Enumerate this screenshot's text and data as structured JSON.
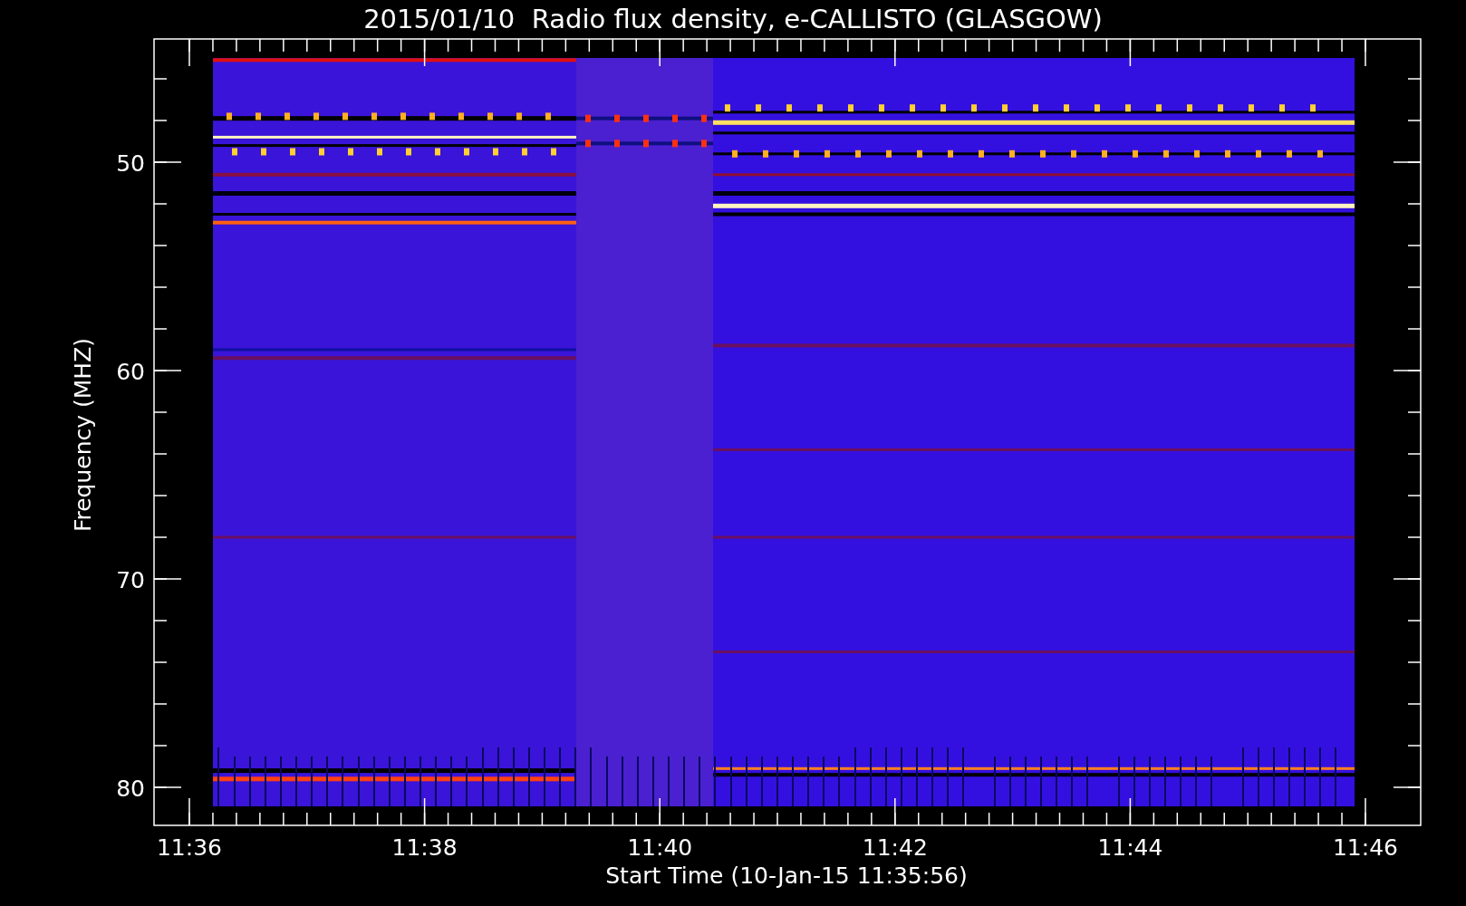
{
  "title": "2015/01/10  Radio flux density, e-CALLISTO (GLASGOW)",
  "y_axis": {
    "label": "Frequency (MHZ)",
    "ticks": [
      "50",
      "60",
      "70",
      "80"
    ]
  },
  "x_axis": {
    "label": "Start Time (10-Jan-15 11:35:56)",
    "ticks": [
      "11:36",
      "11:38",
      "11:40",
      "11:42",
      "11:44",
      "11:46"
    ]
  }
}
